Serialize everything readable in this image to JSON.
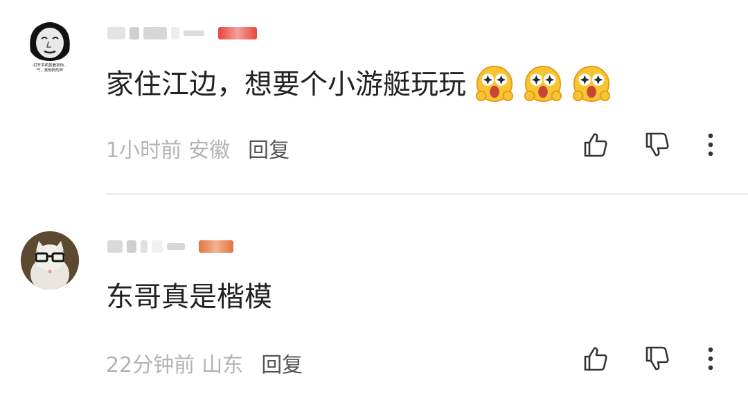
{
  "comments": [
    {
      "avatar_caption_line1": "·打开手机就看到你…",
      "avatar_caption_line2": "气，真他妈的帅",
      "text": "家住江边，想要个小游艇玩玩",
      "emojis": [
        "star-eyes-emoji",
        "star-eyes-emoji",
        "star-eyes-emoji"
      ],
      "time": "1小时前",
      "location": "安徽",
      "reply_label": "回复"
    },
    {
      "text": "东哥真是楷模",
      "time": "22分钟前",
      "location": "山东",
      "reply_label": "回复"
    }
  ],
  "icons": {
    "like": "thumbs-up-icon",
    "dislike": "thumbs-down-icon",
    "more": "more-vertical-icon"
  },
  "colors": {
    "text": "#222222",
    "meta": "#b3b3b3",
    "reply": "#555555",
    "badge1": "#e8453c",
    "badge2": "#e3743e"
  }
}
